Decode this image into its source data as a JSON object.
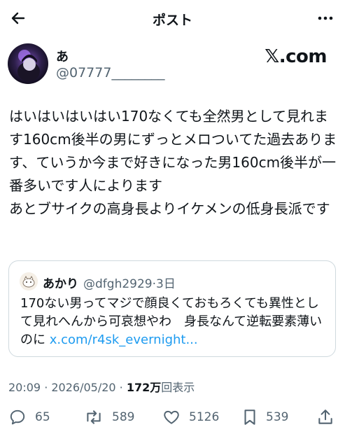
{
  "header": {
    "title": "ポスト",
    "back_icon": "arrow-left-icon",
    "more_icon": "more-horizontal-icon"
  },
  "author": {
    "display_name": "あ",
    "handle": "@07777________",
    "brand": "𝕏.com"
  },
  "post": {
    "text": "はいはいはいはい170なくても全然男として見れます160cm後半の男にずっとメロついてた過去あります、ていうか今まで好きになった男160cm後半が一番多いです人によります\nあとブサイクの高身長よりイケメンの低身長派です"
  },
  "quote": {
    "name": "あかり",
    "meta": "@dfgh2929·3日",
    "text": "170ない男ってマジで顔良くておもろくても異性として見れへんから可哀想やわ　身長なんて逆転要素薄いのに ",
    "link": "x.com/r4sk_evernight..."
  },
  "meta": {
    "time": "20:09 · 2026/05/20 · ",
    "views": "172万",
    "views_label": "回表示"
  },
  "actions": {
    "reply": "65",
    "repost": "589",
    "like": "5126",
    "bookmark": "539"
  },
  "colors": {
    "text": "#0f1419",
    "secondary": "#536471",
    "link": "#1d9bf0",
    "border": "#cfd9de"
  }
}
